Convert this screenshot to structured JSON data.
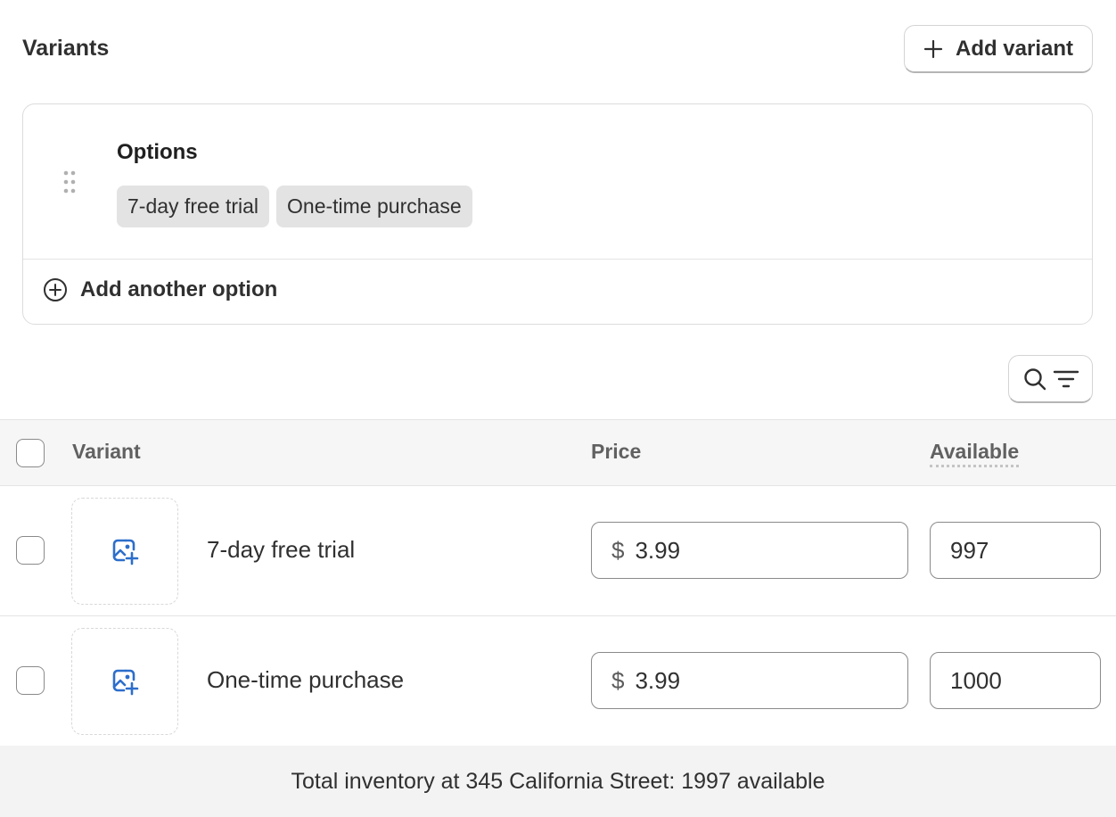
{
  "section": {
    "title": "Variants",
    "add_variant_label": "Add variant"
  },
  "options": {
    "label": "Options",
    "values": [
      "7-day free trial",
      "One-time purchase"
    ],
    "add_option_label": "Add another option"
  },
  "table": {
    "headers": {
      "variant": "Variant",
      "price": "Price",
      "available": "Available"
    },
    "rows": [
      {
        "name": "7-day free trial",
        "currency": "$",
        "price": "3.99",
        "available": "997"
      },
      {
        "name": "One-time purchase",
        "currency": "$",
        "price": "3.99",
        "available": "1000"
      }
    ]
  },
  "footer": {
    "total_text": "Total inventory at 345 California Street: 1997 available"
  },
  "colors": {
    "text": "#303030",
    "muted": "#616161",
    "pill_bg": "#e3e3e3",
    "header_bg": "#f6f6f6",
    "footer_bg": "#f3f3f3",
    "image_icon": "#2c6ecb"
  },
  "icons": {
    "add_variant": "plus-icon",
    "drag": "drag-handle-icon",
    "add_option": "circle-plus-icon",
    "search": "search-icon",
    "filter": "filter-icon",
    "image_upload": "image-add-icon"
  }
}
